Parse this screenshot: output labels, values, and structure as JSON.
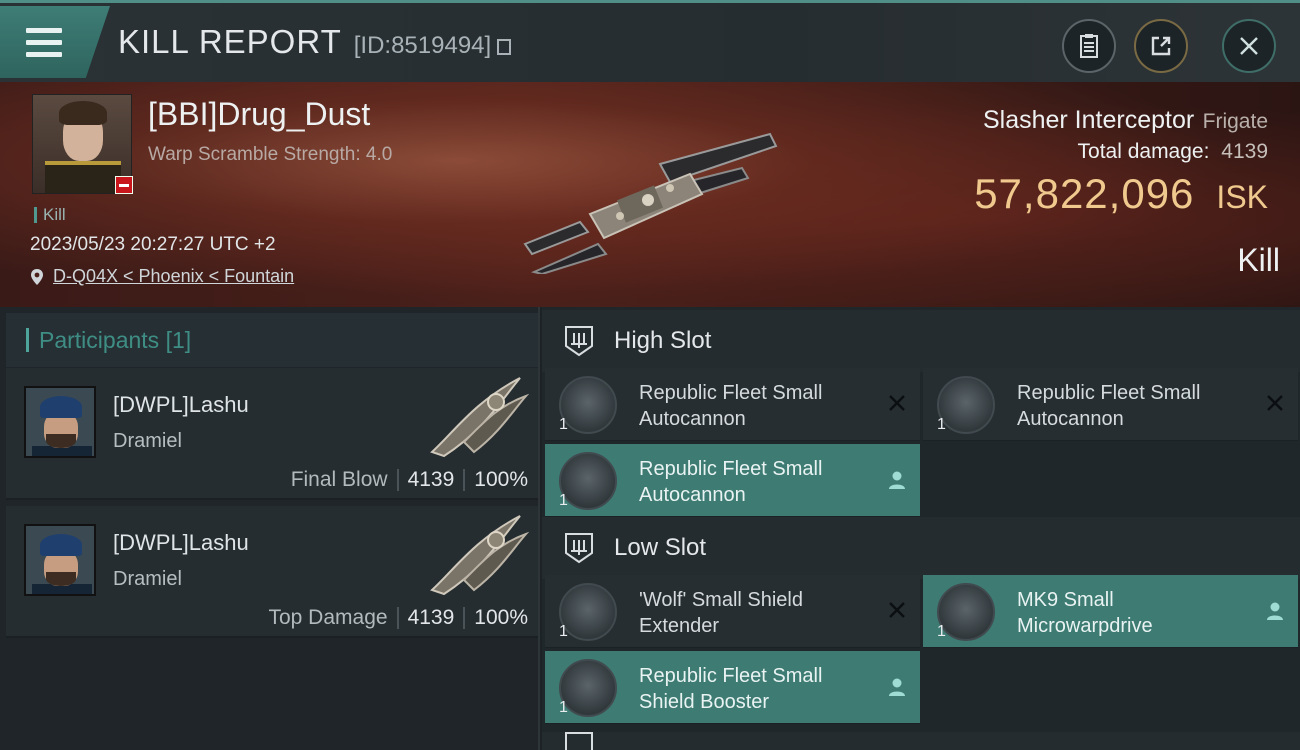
{
  "header": {
    "title": "KILL REPORT",
    "report_id": "[ID:8519494]"
  },
  "victim": {
    "name": "[BBI]Drug_Dust",
    "scramble": "Warp Scramble Strength: 4.0",
    "tag": "Kill",
    "datetime": "2023/05/23 20:27:27 UTC +2",
    "location": "D-Q04X < Phoenix < Fountain",
    "ship_name": "Slasher Interceptor",
    "ship_class": "Frigate",
    "damage_label": "Total damage:",
    "damage_value": "4139",
    "isk_value": "57,822,096",
    "isk_unit": "ISK",
    "result": "Kill"
  },
  "participants": {
    "label": "Participants",
    "count": "[1]",
    "cards": [
      {
        "name": "[DWPL]Lashu",
        "ship": "Dramiel",
        "stat_label": "Final Blow",
        "damage": "4139",
        "percent": "100%"
      },
      {
        "name": "[DWPL]Lashu",
        "ship": "Dramiel",
        "stat_label": "Top Damage",
        "damage": "4139",
        "percent": "100%"
      }
    ]
  },
  "fittings": {
    "high_slot_label": "High Slot",
    "low_slot_label": "Low Slot",
    "modules": [
      {
        "name_l1": "Republic Fleet Small",
        "name_l2": "Autocannon",
        "qty": "1",
        "state": "destroyed"
      },
      {
        "name_l1": "Republic Fleet Small",
        "name_l2": "Autocannon",
        "qty": "1",
        "state": "destroyed"
      },
      {
        "name_l1": "Republic Fleet Small",
        "name_l2": "Autocannon",
        "qty": "1",
        "state": "dropped"
      },
      {
        "name_l1": "'Wolf' Small Shield",
        "name_l2": "Extender",
        "qty": "1",
        "state": "destroyed"
      },
      {
        "name_l1": "MK9 Small",
        "name_l2": "Microwarpdrive",
        "qty": "1",
        "state": "dropped"
      },
      {
        "name_l1": "Republic Fleet Small",
        "name_l2": "Shield Booster",
        "qty": "1",
        "state": "dropped"
      }
    ]
  },
  "colors": {
    "accent_teal": "#3d7b73",
    "isk_gold": "#f0c98e",
    "loss_red": "#c8161c"
  }
}
